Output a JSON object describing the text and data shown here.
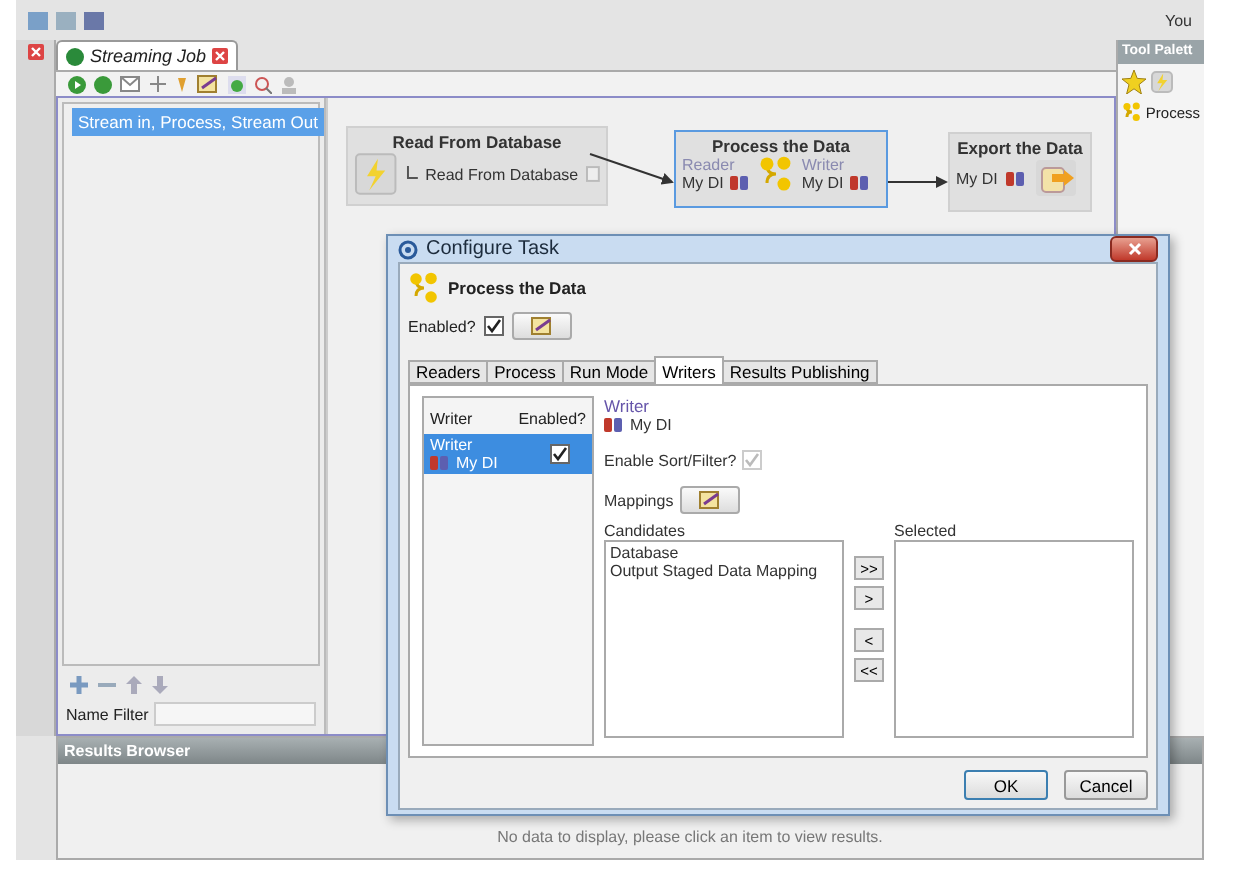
{
  "top_bar": {
    "user_label": "You"
  },
  "editor_tabs": [
    {
      "label": "Streaming Job",
      "selected": true
    }
  ],
  "tree": {
    "items": [
      {
        "label": "Stream in, Process, Stream Out",
        "selected": true
      }
    ]
  },
  "name_filter": {
    "label": "Name Filter"
  },
  "canvas": {
    "nodes": [
      {
        "kind": "reader",
        "title": "Read From Database",
        "item": "Read From Database",
        "selected": false
      },
      {
        "kind": "process",
        "title": "Process the Data",
        "reader_label": "Reader",
        "reader": "My DI",
        "writer_label": "Writer",
        "writer": "My DI",
        "selected": true
      },
      {
        "kind": "export",
        "title": "Export the Data",
        "item": "My DI",
        "selected": false
      }
    ]
  },
  "tool_palette": {
    "title": "Tool Palett",
    "items": [
      {
        "label": "Process"
      }
    ]
  },
  "results_browser": {
    "title": "Results Browser",
    "message": "No data to display, please click an item to view results."
  },
  "dialog": {
    "title": "Configure Task",
    "heading": "Process the Data",
    "enabled_label": "Enabled?",
    "enabled": true,
    "tabs": [
      {
        "label": "Readers",
        "selected": false
      },
      {
        "label": "Process",
        "selected": false
      },
      {
        "label": "Run Mode",
        "selected": false
      },
      {
        "label": "Writers",
        "selected": true
      },
      {
        "label": "Results Publishing",
        "selected": false
      }
    ],
    "writers_table": {
      "columns": [
        "Writer",
        "Enabled?"
      ],
      "rows": [
        {
          "type": "Writer",
          "name": "My DI",
          "enabled": true,
          "selected": true
        }
      ]
    },
    "detail": {
      "type": "Writer",
      "name": "My DI",
      "sort_filter_label": "Enable Sort/Filter?",
      "sort_filter": true,
      "sort_filter_disabled": true,
      "mappings_label": "Mappings",
      "candidates_label": "Candidates",
      "candidates": [
        "Database",
        "Output Staged Data Mapping"
      ],
      "selected_label": "Selected",
      "move_buttons": [
        ">>",
        ">",
        "<",
        "<<"
      ]
    },
    "buttons": [
      "OK",
      "Cancel"
    ]
  }
}
